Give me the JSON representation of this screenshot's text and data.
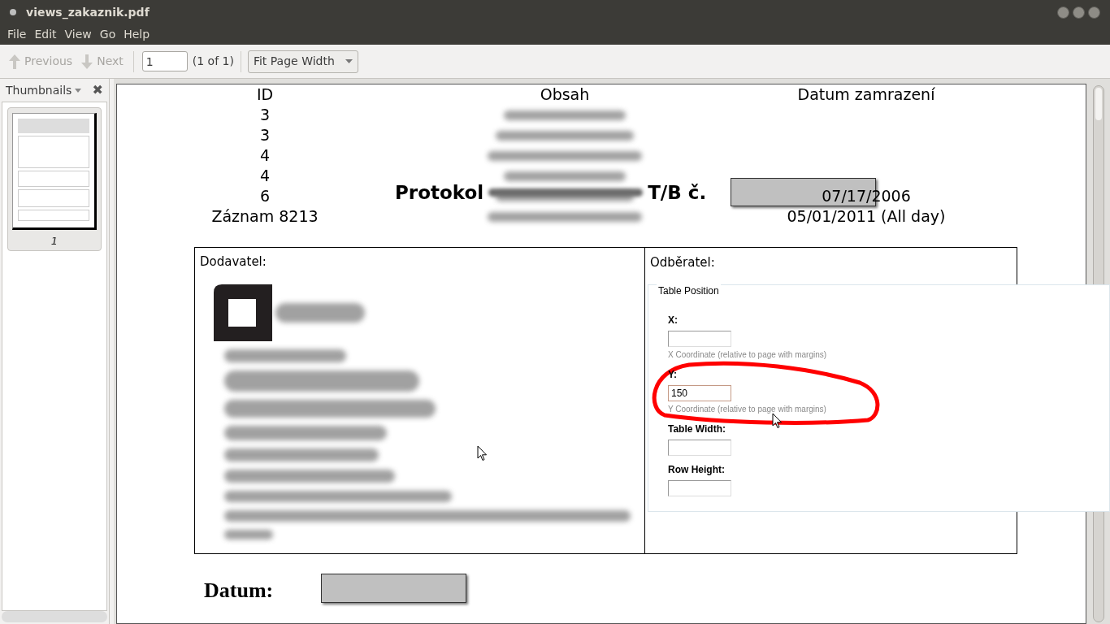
{
  "window": {
    "title": "views_zakaznik.pdf"
  },
  "menu": [
    "File",
    "Edit",
    "View",
    "Go",
    "Help"
  ],
  "toolbar": {
    "previous": {
      "label": "Previous",
      "disabled": true
    },
    "next": {
      "label": "Next",
      "disabled": true
    },
    "page": "1",
    "page_count": "(1 of 1)",
    "zoom": "Fit Page Width"
  },
  "sidebar": {
    "title": "Thumbnails",
    "close": "✖",
    "thumbnails": [
      {
        "label": "1",
        "selected": true
      }
    ]
  },
  "document": {
    "columns": [
      "ID",
      "Obsah",
      "Datum zamrazení"
    ],
    "rows": [
      {
        "id": "3",
        "date": ""
      },
      {
        "id": "3",
        "date": ""
      },
      {
        "id": "4",
        "date": ""
      },
      {
        "id": "4",
        "date": ""
      },
      {
        "id": "6",
        "date": "07/17/2006"
      },
      {
        "id": "Záznam 8213",
        "date": "05/01/2011 (All day)"
      }
    ],
    "title_start": "Protokol",
    "title_end": "T/B č.",
    "supplier_label": "Dodavatel:",
    "customer_label": "Odběratel:",
    "date_label": "Datum:"
  },
  "panel": {
    "legend": "Table Position",
    "fields": [
      {
        "label": "X:",
        "hint": "X Coordinate (relative to page with margins)",
        "focused": false
      },
      {
        "label": "Y:",
        "value": "150",
        "hint": "Y Coordinate (relative to page with margins)",
        "focused": true
      },
      {
        "label": "Table Width:",
        "focused": false
      },
      {
        "label": "Row Height:",
        "focused": false
      }
    ]
  }
}
